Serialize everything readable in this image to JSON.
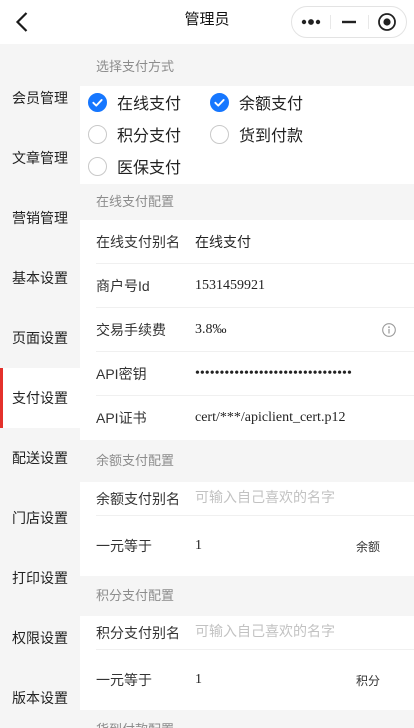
{
  "header": {
    "title": "管理员",
    "back_icon": "chevron-left-icon",
    "capsule_icons": [
      "more-dots-icon",
      "minimize-icon",
      "target-icon"
    ]
  },
  "sidebar": {
    "active_index": 5,
    "items": [
      {
        "label": "会员管理"
      },
      {
        "label": "文章管理"
      },
      {
        "label": "营销管理"
      },
      {
        "label": "基本设置"
      },
      {
        "label": "页面设置"
      },
      {
        "label": "支付设置"
      },
      {
        "label": "配送设置"
      },
      {
        "label": "门店设置"
      },
      {
        "label": "打印设置"
      },
      {
        "label": "权限设置"
      },
      {
        "label": "版本设置"
      }
    ]
  },
  "main": {
    "payment_methods": {
      "title": "选择支付方式",
      "options": [
        {
          "label": "在线支付",
          "checked": true
        },
        {
          "label": "余额支付",
          "checked": true
        },
        {
          "label": "积分支付",
          "checked": false
        },
        {
          "label": "货到付款",
          "checked": false
        },
        {
          "label": "医保支付",
          "checked": false
        }
      ]
    },
    "online_pay": {
      "title": "在线支付配置",
      "rows": [
        {
          "label": "在线支付别名",
          "value": "在线支付"
        },
        {
          "label": "商户号Id",
          "value": "1531459921"
        },
        {
          "label": "交易手续费",
          "value": "3.8‰",
          "icon": "info-icon"
        },
        {
          "label": "API密钥",
          "value": "••••••••••••••••••••••••••••••••"
        },
        {
          "label": "API证书",
          "value": "cert/***/apiclient_cert.p12"
        }
      ]
    },
    "balance_pay": {
      "title": "余额支付配置",
      "alias_label": "余额支付别名",
      "alias_placeholder": "可输入自己喜欢的名字",
      "rate_label": "一元等于",
      "rate_value": "1",
      "rate_unit": "余额"
    },
    "points_pay": {
      "title": "积分支付配置",
      "alias_label": "积分支付别名",
      "alias_placeholder": "可输入自己喜欢的名字",
      "rate_label": "一元等于",
      "rate_value": "1",
      "rate_unit": "积分"
    },
    "cod": {
      "title": "货到付款配置"
    }
  },
  "colors": {
    "accent": "#1677ff",
    "active_bar": "#e4312b",
    "section_bg": "#f5f5f5",
    "placeholder": "#c2c2c2"
  }
}
